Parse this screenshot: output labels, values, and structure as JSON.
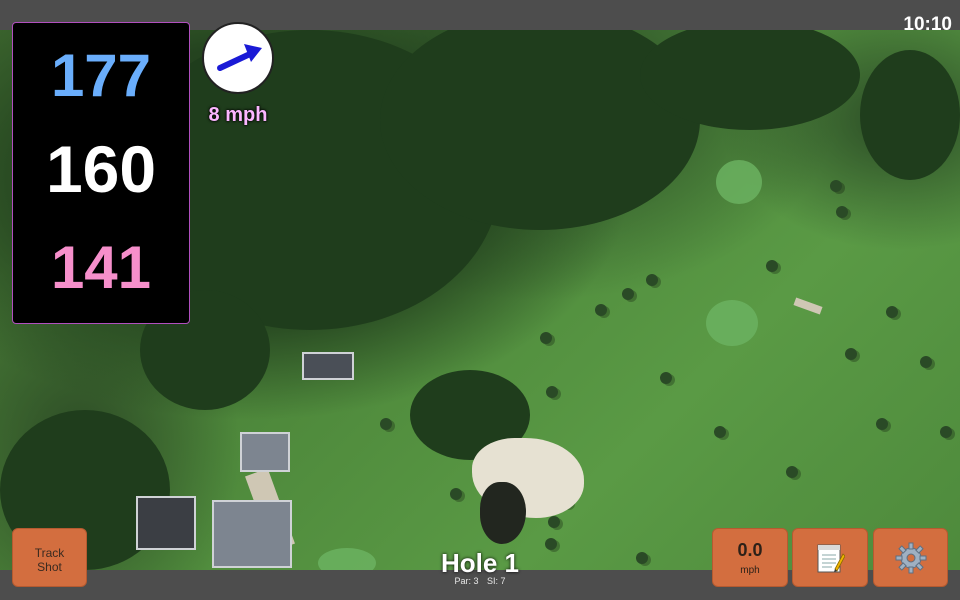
{
  "status": {
    "time": "10:10"
  },
  "distances": {
    "back": "177",
    "middle": "160",
    "front": "141"
  },
  "wind": {
    "speed": "8 mph",
    "icon": "wind-arrow-icon"
  },
  "track_button": {
    "line1": "Track",
    "line2": "Shot"
  },
  "speed_button": {
    "value": "0.0",
    "unit": "mph"
  },
  "notes_button": {
    "icon": "notepad-icon"
  },
  "settings_button": {
    "icon": "gear-icon"
  },
  "hole": {
    "title": "Hole 1",
    "par": "Par: 3",
    "si": "SI: 7"
  },
  "colors": {
    "back": "#6aaefc",
    "middle": "#ffffff",
    "front": "#f68fcb",
    "accent": "#d36e3f",
    "wind_text": "#fbb6ff"
  }
}
